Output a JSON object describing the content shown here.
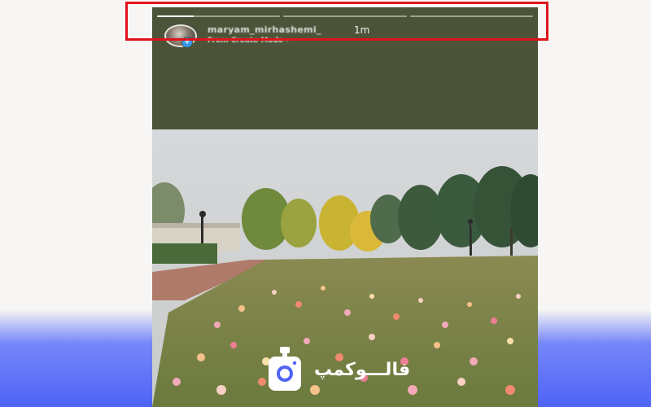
{
  "story": {
    "username": "maryam_mirhashemi_",
    "time": "1m",
    "source": "From Create Mode ›",
    "progress_segments": [
      0.3,
      0,
      0
    ],
    "frame_color": "#4b5438",
    "highlight_color": "#e0131d"
  },
  "branding": {
    "name": "فالـــوکمپ",
    "accent": "#4f63f5"
  },
  "icons": {
    "badge": "plus-badge-icon",
    "logo": "camera-logo-icon"
  }
}
